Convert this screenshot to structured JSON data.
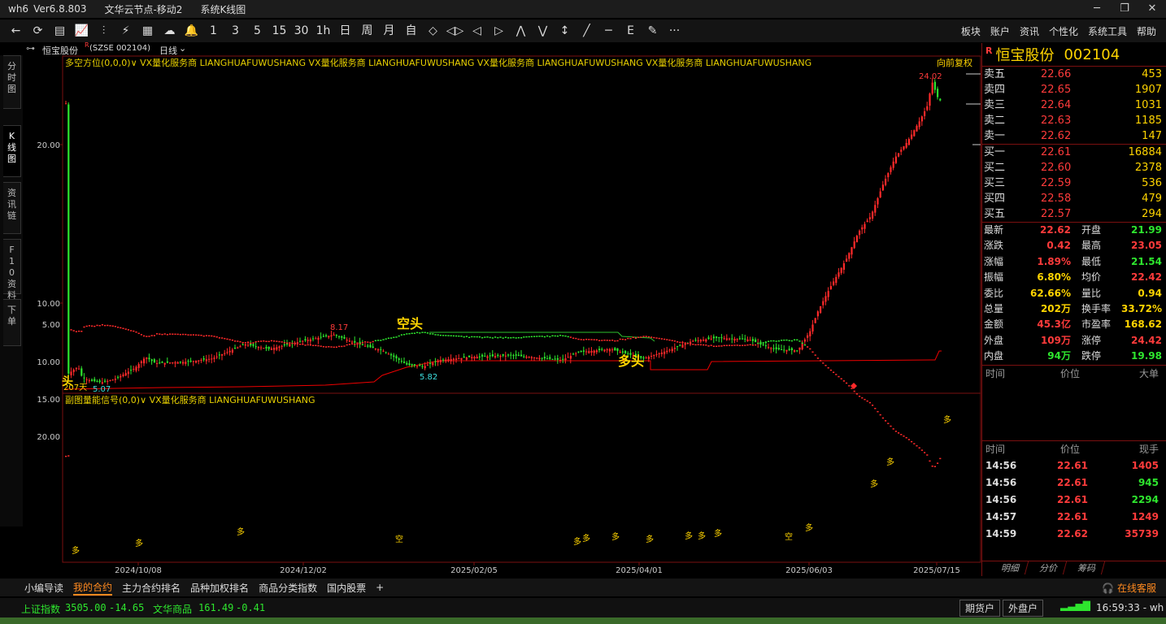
{
  "titlebar": {
    "app": "wh6",
    "version": "Ver6.8.803",
    "node": "文华云节点-移动2",
    "view": "系统K线图"
  },
  "toolbar": {
    "buttons": [
      "←",
      "⟳",
      "▤",
      "📈",
      "⫶",
      "⚡",
      "▦",
      "☁",
      "🔔",
      "1",
      "3",
      "5",
      "15",
      "30",
      "1h",
      "日",
      "周",
      "月",
      "自",
      "◇",
      "◁▷",
      "◁",
      "▷",
      "⋀",
      "⋁",
      "↕",
      "╱",
      "─",
      "E",
      "✎",
      "···"
    ],
    "menu": [
      "板块",
      "账户",
      "资讯",
      "个性化",
      "系统工具",
      "帮助"
    ]
  },
  "header": {
    "name": "恒宝股份",
    "sup": "R",
    "code": "(SZSE 002104)",
    "period": "日线"
  },
  "sidetabs": [
    "分时图",
    "K线图",
    "资讯链",
    "F10资料",
    "下单"
  ],
  "main_chart": {
    "indicator_line": "多空方位(0,0,0)∨  VX量化服务商  LIANGHUAFUWUSHANG  VX量化服务商  LIANGHUAFUWUSHANG  VX量化服务商  LIANGHUAFUWUSHANG  VX量化服务商  LIANGHUAFUWUSHANG",
    "right_label": "向前复权",
    "yticks": [
      "20.00",
      "10.00"
    ],
    "annotations": {
      "high": "24.02",
      "p817": "8.17",
      "p582": "5.82",
      "p507": "5.07",
      "days": "207天",
      "kong": "空头",
      "duo": "多头",
      "left": "头"
    }
  },
  "sub_chart": {
    "indicator_line": "副图量能信号(0,0)∨  VX量化服务商  LIANGHUAFUWUSHANG",
    "yticks": [
      "20.00",
      "15.00",
      "10.00",
      "5.00"
    ],
    "labels": [
      "多",
      "多",
      "多",
      "空",
      "多",
      "多",
      "多",
      "多",
      "多",
      "多",
      "多",
      "空",
      "多",
      "多",
      "多",
      "多"
    ]
  },
  "xaxis": [
    "2024/10/08",
    "2024/12/02",
    "2025/02/05",
    "2025/04/01",
    "2025/06/03",
    "2025/07/15"
  ],
  "quote": {
    "name": "恒宝股份",
    "code": "002104",
    "flag": "R",
    "asks": [
      {
        "l": "卖五",
        "p": "22.66",
        "v": "453"
      },
      {
        "l": "卖四",
        "p": "22.65",
        "v": "1907"
      },
      {
        "l": "卖三",
        "p": "22.64",
        "v": "1031"
      },
      {
        "l": "卖二",
        "p": "22.63",
        "v": "1185"
      },
      {
        "l": "卖一",
        "p": "22.62",
        "v": "147"
      }
    ],
    "bids": [
      {
        "l": "买一",
        "p": "22.61",
        "v": "16884"
      },
      {
        "l": "买二",
        "p": "22.60",
        "v": "2378"
      },
      {
        "l": "买三",
        "p": "22.59",
        "v": "536"
      },
      {
        "l": "买四",
        "p": "22.58",
        "v": "479"
      },
      {
        "l": "买五",
        "p": "22.57",
        "v": "294"
      }
    ],
    "stats": [
      {
        "a": "最新",
        "b": "22.62",
        "bc": "#ff3b3b",
        "c": "开盘",
        "d": "21.99",
        "dc": "#2ee52e"
      },
      {
        "a": "涨跌",
        "b": "0.42",
        "bc": "#ff3b3b",
        "c": "最高",
        "d": "23.05",
        "dc": "#ff3b3b"
      },
      {
        "a": "涨幅",
        "b": "1.89%",
        "bc": "#ff3b3b",
        "c": "最低",
        "d": "21.54",
        "dc": "#2ee52e"
      },
      {
        "a": "振幅",
        "b": "6.80%",
        "bc": "#ffd400",
        "c": "均价",
        "d": "22.42",
        "dc": "#ff3b3b"
      },
      {
        "a": "委比",
        "b": "62.66%",
        "bc": "#ffd400",
        "c": "量比",
        "d": "0.94",
        "dc": "#ffd400"
      },
      {
        "a": "总量",
        "b": "202万",
        "bc": "#ffd400",
        "c": "换手率",
        "d": "33.72%",
        "dc": "#ffd400"
      },
      {
        "a": "金额",
        "b": "45.3亿",
        "bc": "#ff3b3b",
        "c": "市盈率",
        "d": "168.62",
        "dc": "#ffd400"
      },
      {
        "a": "外盘",
        "b": "109万",
        "bc": "#ff3b3b",
        "c": "涨停",
        "d": "24.42",
        "dc": "#ff3b3b"
      },
      {
        "a": "内盘",
        "b": "94万",
        "bc": "#2ee52e",
        "c": "跌停",
        "d": "19.98",
        "dc": "#2ee52e"
      }
    ],
    "big_header": [
      "时间",
      "价位",
      "大单"
    ],
    "tick_header": [
      "时间",
      "价位",
      "现手"
    ],
    "ticks": [
      {
        "t": "14:56",
        "p": "22.61",
        "v": "1405",
        "vc": "#ff3b3b"
      },
      {
        "t": "14:56",
        "p": "22.61",
        "v": "945",
        "vc": "#2ee52e"
      },
      {
        "t": "14:56",
        "p": "22.61",
        "v": "2294",
        "vc": "#2ee52e"
      },
      {
        "t": "14:57",
        "p": "22.61",
        "v": "1249",
        "vc": "#ff3b3b"
      },
      {
        "t": "14:59",
        "p": "22.62",
        "v": "35739",
        "vc": "#ff3b3b"
      }
    ],
    "bottom_tabs": [
      "明细",
      "分价",
      "筹码"
    ]
  },
  "bottom_tabs": [
    "小编导读",
    "我的合约",
    "主力合约排名",
    "品种加权排名",
    "商品分类指数",
    "国内股票",
    "+"
  ],
  "service": "在线客服",
  "status": {
    "idx1_name": "上证指数",
    "idx1_val": "3505.00",
    "idx1_chg": "-14.65",
    "idx2_name": "文华商品",
    "idx2_val": "161.49",
    "idx2_chg": "-0.41",
    "btn1": "期货户",
    "btn2": "外盘户",
    "clock": "16:59:33 - wh"
  },
  "colors": {
    "up": "#ff2a2a",
    "down": "#2ee52e",
    "accent": "#ffd400",
    "border": "#7a1010"
  }
}
